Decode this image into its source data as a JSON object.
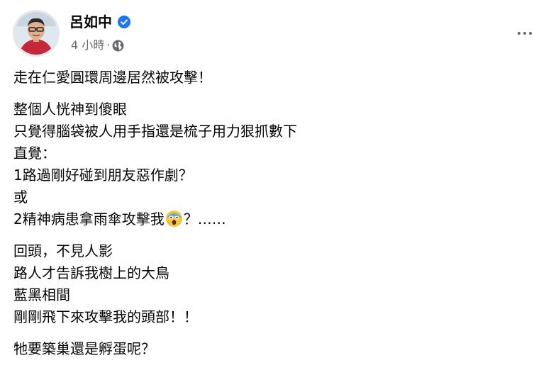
{
  "post": {
    "author": "呂如中",
    "time": "4 小時",
    "separator": "·",
    "more_icon": "ellipsis-icon",
    "verified_icon": "verified-badge-icon",
    "privacy_icon": "globe-icon",
    "paragraphs": [
      [
        "走在仁愛圓環周邊居然被攻擊！"
      ],
      [
        "整個人恍神到傻眼",
        "只覺得腦袋被人用手指還是梳子用力狠抓數下",
        "直覺：",
        "1路過剛好碰到朋友惡作劇？",
        "或"
      ],
      [
        "回頭，不見人影",
        "路人才告訴我樹上的大鳥",
        "藍黑相間",
        "剛剛飛下來攻擊我的頭部！！"
      ],
      [
        "牠要築巢還是孵蛋呢？"
      ]
    ],
    "line_with_emoji": {
      "before": "2精神病患拿雨傘攻擊我",
      "emoji": "screaming-face-emoji",
      "after": "？……"
    }
  },
  "colors": {
    "verified": "#1877f2",
    "secondary_text": "#65676b",
    "primary_text": "#050505"
  }
}
